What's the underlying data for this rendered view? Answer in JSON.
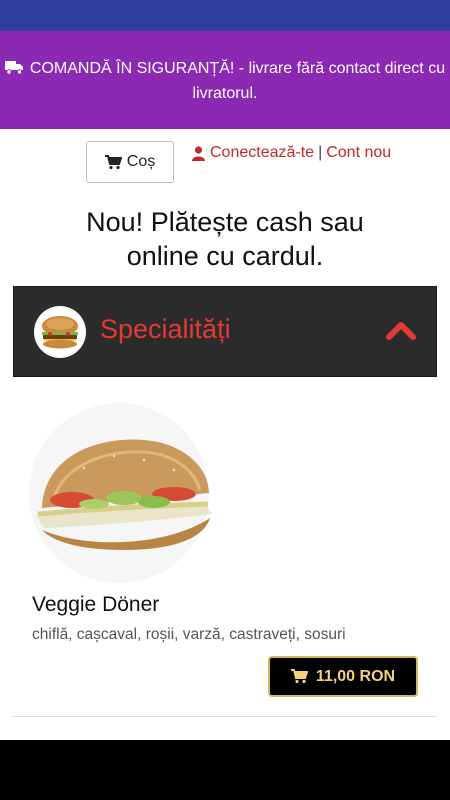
{
  "banner": {
    "text": "COMANDĂ ÎN SIGURANȚĂ! - livrare fără contact direct cu livratorul."
  },
  "header": {
    "cart_label": "Coș",
    "login_label": "Conectează-te",
    "separator": "|",
    "register_label": "Cont nou"
  },
  "headline": {
    "line1": "Nou! Plătește cash sau",
    "line2": "online cu cardul."
  },
  "category": {
    "title": "Specialități"
  },
  "product": {
    "name": "Veggie Döner",
    "description": "chiflă, cașcaval, roșii, varză, castraveți, sosuri",
    "price": "11,00 RON"
  },
  "colors": {
    "status_bar": "#2f3d9e",
    "banner": "#8b29b3",
    "accent_red": "#e53935",
    "price_gold": "#d6b65b",
    "category_bg": "#2b2b2b"
  },
  "icons": {
    "banner": "truck-icon",
    "cart": "cart-icon",
    "user": "user-icon",
    "toggle": "chevron-up-icon"
  }
}
